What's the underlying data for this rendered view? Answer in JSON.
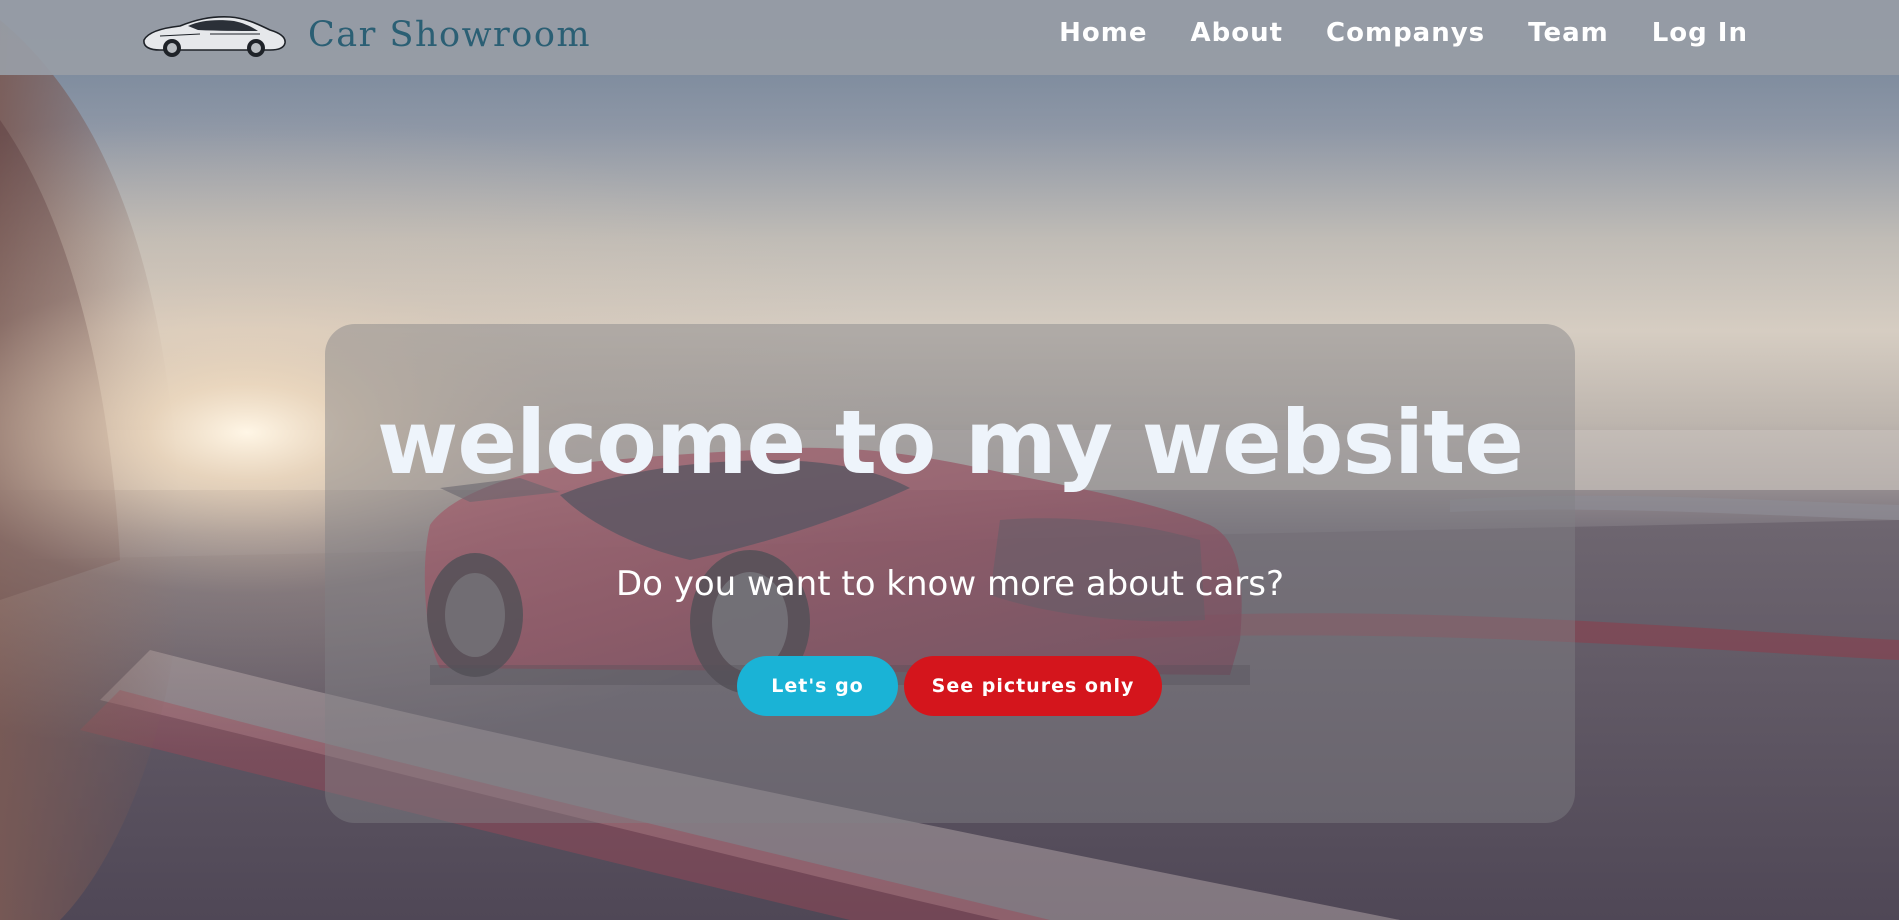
{
  "brand": {
    "name": "Car Showroom",
    "logo_icon": "car-logo-icon"
  },
  "nav": {
    "items": [
      {
        "label": "Home"
      },
      {
        "label": "About"
      },
      {
        "label": "Companys"
      },
      {
        "label": "Team"
      },
      {
        "label": "Log In"
      }
    ]
  },
  "hero": {
    "title": "welcome to my website",
    "subtitle": "Do you want to know more about cars?",
    "primary_button": "Let's go",
    "secondary_button": "See pictures only",
    "background_image": "red-sports-car-on-race-track"
  },
  "colors": {
    "brand_text": "#2b5f74",
    "primary_button": "#1ab3d6",
    "secondary_button": "#d4151c",
    "navbar": "#989da6"
  }
}
